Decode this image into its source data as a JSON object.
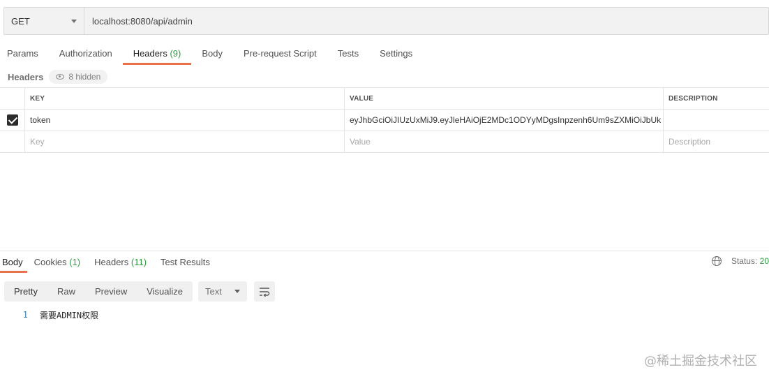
{
  "request": {
    "method": "GET",
    "url": "localhost:8080/api/admin"
  },
  "request_tabs": [
    {
      "label": "Params",
      "count": ""
    },
    {
      "label": "Authorization",
      "count": ""
    },
    {
      "label": "Headers",
      "count": "(9)"
    },
    {
      "label": "Body",
      "count": ""
    },
    {
      "label": "Pre-request Script",
      "count": ""
    },
    {
      "label": "Tests",
      "count": ""
    },
    {
      "label": "Settings",
      "count": ""
    }
  ],
  "headers_section": {
    "label": "Headers",
    "hidden_label": "8 hidden"
  },
  "table": {
    "columns": [
      "KEY",
      "VALUE",
      "DESCRIPTION"
    ],
    "rows": [
      {
        "checked": true,
        "key": "token",
        "value": "eyJhbGciOiJIUzUxMiJ9.eyJleHAiOjE2MDc1ODYyMDgsInpzenh6Um9sZXMiOiJbUk",
        "description": ""
      }
    ],
    "placeholders": {
      "key": "Key",
      "value": "Value",
      "description": "Description"
    }
  },
  "response_tabs": [
    {
      "label": "Body",
      "count": ""
    },
    {
      "label": "Cookies",
      "count": "(1)"
    },
    {
      "label": "Headers",
      "count": "(11)"
    },
    {
      "label": "Test Results",
      "count": ""
    }
  ],
  "status": {
    "label": "Status:",
    "value": "20"
  },
  "format_buttons": [
    "Pretty",
    "Raw",
    "Preview",
    "Visualize"
  ],
  "format_select": "Text",
  "response_body": {
    "line_number": "1",
    "text": "需要ADMIN权限"
  },
  "watermark": "@稀土掘金技术社区",
  "icons": {
    "method_caret": "chevron-down-icon",
    "eye": "eye-icon",
    "globe": "globe-icon",
    "wrap": "wrap-lines-icon"
  }
}
